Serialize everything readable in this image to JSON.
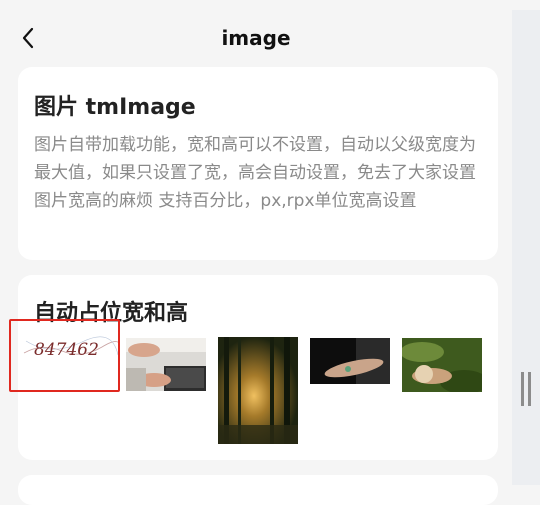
{
  "header": {
    "title": "image",
    "back_icon": "chevron-left-icon"
  },
  "card1": {
    "title": "图片 tmImage",
    "description": "图片自带加载功能，宽和高可以不设置，自动以父级宽度为最大值，如果只设置了宽，高会自动设置，免去了大家设置图片宽高的麻烦 支持百分比，px,rpx单位宽高设置"
  },
  "card2": {
    "title": "自动占位宽和高",
    "captcha_text": "847462"
  },
  "colors": {
    "highlight_border": "#e0281f",
    "page_bg": "#f5f5f5",
    "card_bg": "#ffffff"
  }
}
